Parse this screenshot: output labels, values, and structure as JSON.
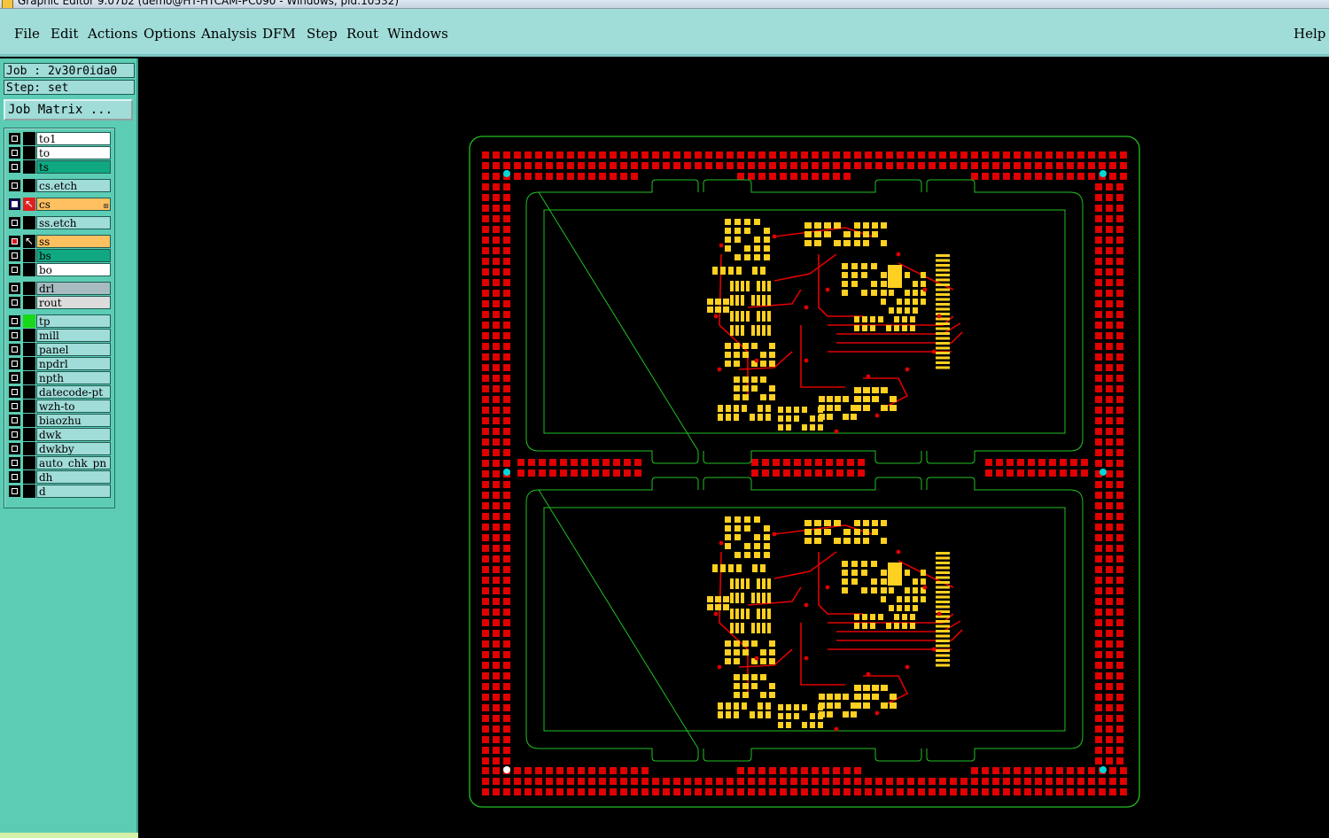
{
  "window": {
    "title": "Graphic Editor 9.07b2 (demo@HT-HTCAM-PC090 - Windows, pid:10532)"
  },
  "menubar": {
    "file": "File",
    "edit": "Edit",
    "actions": "Actions",
    "options": "Options",
    "analysis": "Analysis",
    "dfm": "DFM",
    "step": "Step",
    "rout": "Rout",
    "windows": "Windows",
    "help": "Help"
  },
  "job": {
    "label": "Job : 2v30r0ida0",
    "step": "Step: set",
    "matrix_button": "Job Matrix ..."
  },
  "layers": [
    {
      "name": "to1",
      "color": "#ffffff"
    },
    {
      "name": "to",
      "color": "#ffffff"
    },
    {
      "name": "ts",
      "color": "#10a880"
    },
    {
      "name": "cs.etch",
      "color": "#a0dcd8"
    },
    {
      "name": "cs",
      "color": "#ffc060",
      "state": "affected"
    },
    {
      "name": "ss.etch",
      "color": "#a0dcd8"
    },
    {
      "name": "ss",
      "color": "#ffc060",
      "state": "displayed"
    },
    {
      "name": "bs",
      "color": "#10a880"
    },
    {
      "name": "bo",
      "color": "#ffffff"
    },
    {
      "name": "drl",
      "color": "#a8bcc0"
    },
    {
      "name": "rout",
      "color": "#dcdcdc"
    },
    {
      "name": "tp",
      "color": "#a0dcd8"
    },
    {
      "name": "mill",
      "color": "#a0dcd8"
    },
    {
      "name": "panel",
      "color": "#a0dcd8"
    },
    {
      "name": "npdrl",
      "color": "#a0dcd8"
    },
    {
      "name": "npth",
      "color": "#a0dcd8"
    },
    {
      "name": "datecode-pt",
      "color": "#a0dcd8"
    },
    {
      "name": "wzh-to",
      "color": "#a0dcd8"
    },
    {
      "name": "biaozhu",
      "color": "#a0dcd8"
    },
    {
      "name": "dwk",
      "color": "#a0dcd8"
    },
    {
      "name": "dwkby",
      "color": "#a0dcd8"
    },
    {
      "name": "auto_chk_pn",
      "color": "#a0dcd8"
    },
    {
      "name": "dh",
      "color": "#a0dcd8"
    },
    {
      "name": "d",
      "color": "#a0dcd8"
    }
  ],
  "colors": {
    "panel_bg": "#5ccdb4",
    "menubar_bg": "#a0dcd8",
    "canvas_bg": "#000000",
    "profile_outline": "#22c022",
    "copper_pad": "#e00000",
    "smd_pad": "#ffd020",
    "fiducial": "#00d8d8"
  },
  "canvas": {
    "panel_count": 2
  }
}
